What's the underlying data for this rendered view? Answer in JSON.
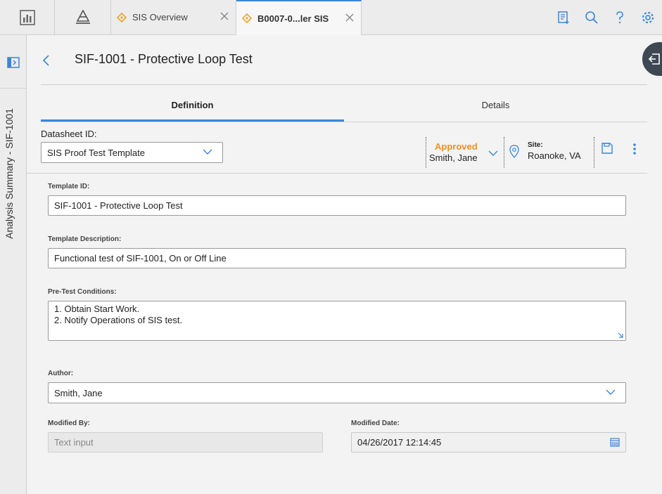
{
  "tabs": [
    {
      "label": "SIS Overview"
    },
    {
      "label": "B0007-0...ler SIS"
    }
  ],
  "rail": {
    "title": "Analysis Summary - SIF-1001"
  },
  "page": {
    "title": "SIF-1001 - Protective Loop Test"
  },
  "subtabs": {
    "definition": "Definition",
    "details": "Details"
  },
  "datasheet": {
    "label": "Datasheet ID:",
    "value": "SIS Proof Test Template"
  },
  "status": {
    "state": "Approved",
    "user": "Smith, Jane"
  },
  "site": {
    "label": "Site:",
    "value": "Roanoke, VA"
  },
  "fields": {
    "template_id": {
      "label": "Template ID:",
      "value": "SIF-1001 - Protective Loop Test"
    },
    "template_desc": {
      "label": "Template Description:",
      "value": "Functional test of SIF-1001, On or Off Line"
    },
    "pretest": {
      "label": "Pre-Test Conditions:",
      "line1": "1. Obtain Start Work.",
      "line2": "2. Notify Operations of SIS test."
    },
    "author": {
      "label": "Author:",
      "value": "Smith, Jane"
    },
    "modified_by": {
      "label": "Modified By:",
      "placeholder": "Text input"
    },
    "modified_date": {
      "label": "Modified Date:",
      "value": "04/26/2017 12:14:45"
    }
  },
  "colors": {
    "accent": "#3a86d6",
    "status": "#f0901e",
    "icon": "#3a86d6"
  }
}
